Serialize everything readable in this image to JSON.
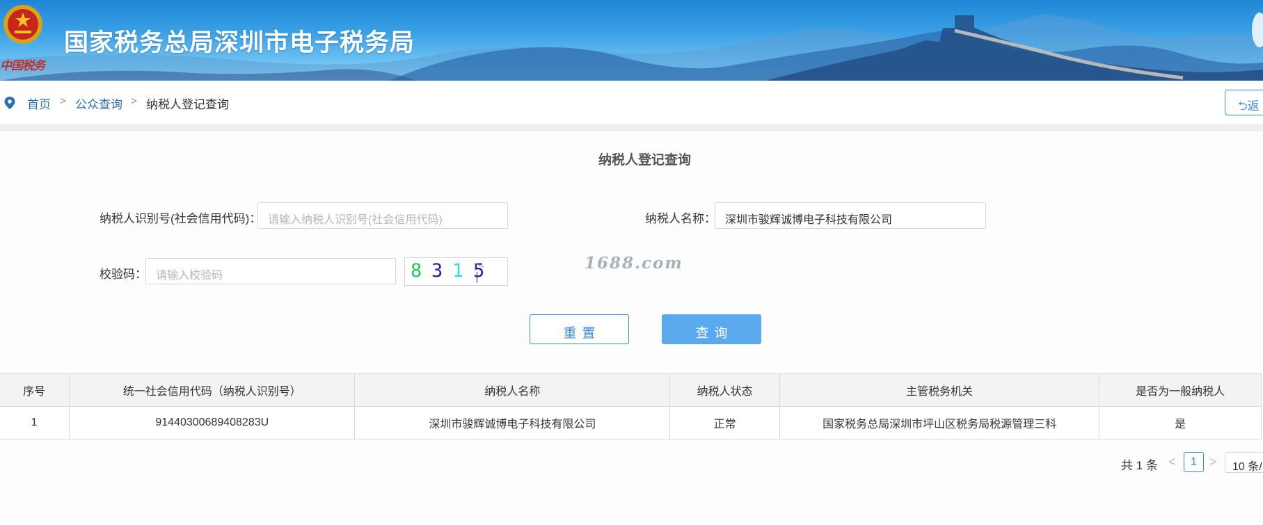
{
  "banner": {
    "title": "国家税务总局深圳市电子税务局",
    "sub_logo_text": "中国税务"
  },
  "breadcrumb": {
    "home": "首页",
    "public_query": "公众查询",
    "current": "纳税人登记查询",
    "separator": ">"
  },
  "back_button": {
    "label": "返"
  },
  "form": {
    "title": "纳税人登记查询",
    "taxpayer_id_label": "纳税人识别号(社会信用代码)：",
    "taxpayer_id_placeholder": "请输入纳税人识别号(社会信用代码)",
    "taxpayer_name_label": "纳税人名称：",
    "taxpayer_name_value": "深圳市骏辉诚博电子科技有限公司",
    "captcha_label": "校验码：",
    "captcha_placeholder": "请输入校验码",
    "captcha_chars": [
      {
        "char": "8",
        "color": "#22c55e"
      },
      {
        "char": "3",
        "color": "#1e2aa0"
      },
      {
        "char": "1",
        "color": "#38d9e0"
      },
      {
        "char": "5",
        "color": "#1e2aa0"
      }
    ],
    "watermark": "1688.com",
    "reset_label": "重置",
    "search_label": "查询"
  },
  "table": {
    "headers": [
      "序号",
      "统一社会信用代码（纳税人识别号）",
      "纳税人名称",
      "纳税人状态",
      "主管税务机关",
      "是否为一般纳税人"
    ],
    "rows": [
      [
        "1",
        "91440300689408283U",
        "深圳市骏辉诚博电子科技有限公司",
        "正常",
        "国家税务总局深圳市坪山区税务局税源管理三科",
        "是"
      ]
    ]
  },
  "pagination": {
    "total": "共 1 条",
    "prev": "<",
    "next": ">",
    "current_page": "1",
    "page_size": "10 条/"
  },
  "colors": {
    "accent": "#3a8be0",
    "search_button": "#5aa9ee",
    "link": "#2a6fb6"
  }
}
